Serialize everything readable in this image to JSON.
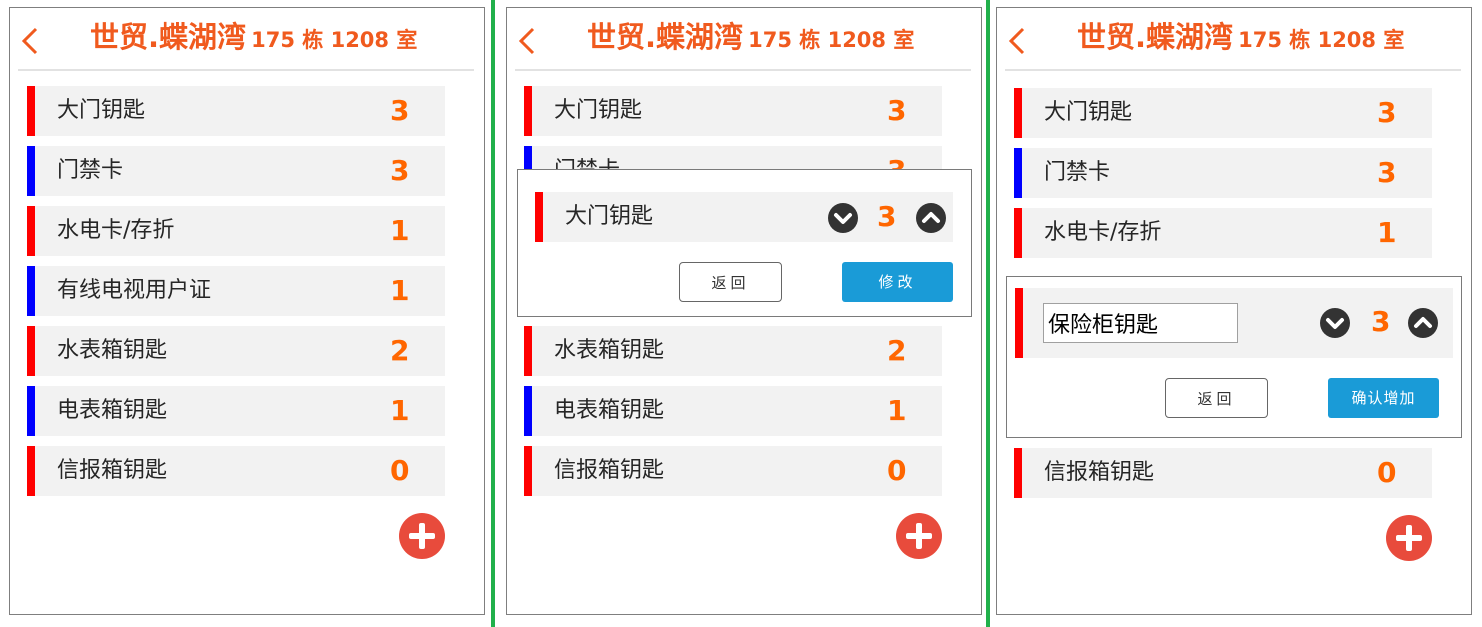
{
  "header": {
    "title_name": "世贸.蝶湖湾",
    "title_rest": "175 栋 1208 室"
  },
  "items": [
    {
      "label": "大门钥匙",
      "count": "3",
      "color": "#ff0000"
    },
    {
      "label": "门禁卡",
      "count": "3",
      "color": "#0000ff"
    },
    {
      "label": "水电卡/存折",
      "count": "1",
      "color": "#ff0000"
    },
    {
      "label": "有线电视用户证",
      "count": "1",
      "color": "#0000ff"
    },
    {
      "label": "水表箱钥匙",
      "count": "2",
      "color": "#ff0000"
    },
    {
      "label": "电表箱钥匙",
      "count": "1",
      "color": "#0000ff"
    },
    {
      "label": "信报箱钥匙",
      "count": "0",
      "color": "#ff0000"
    }
  ],
  "partial_label": "门禁卡",
  "edit_dialog": {
    "label": "大门钥匙",
    "count": "3",
    "back_label": "返回",
    "confirm_label": "修改"
  },
  "add_dialog": {
    "input_value": "保险柜钥匙",
    "count": "3",
    "back_label": "返回",
    "confirm_label": "确认增加"
  },
  "icons": {
    "back": "chevron-left-icon",
    "decrease": "chevron-down-circle-icon",
    "increase": "chevron-up-circle-icon",
    "add": "plus-circle-icon"
  },
  "colors": {
    "accent": "#f05a1e",
    "count": "#ff6600",
    "fab": "#e84b3c",
    "primary_button": "#1a9bd7",
    "divider": "#21b04b"
  }
}
